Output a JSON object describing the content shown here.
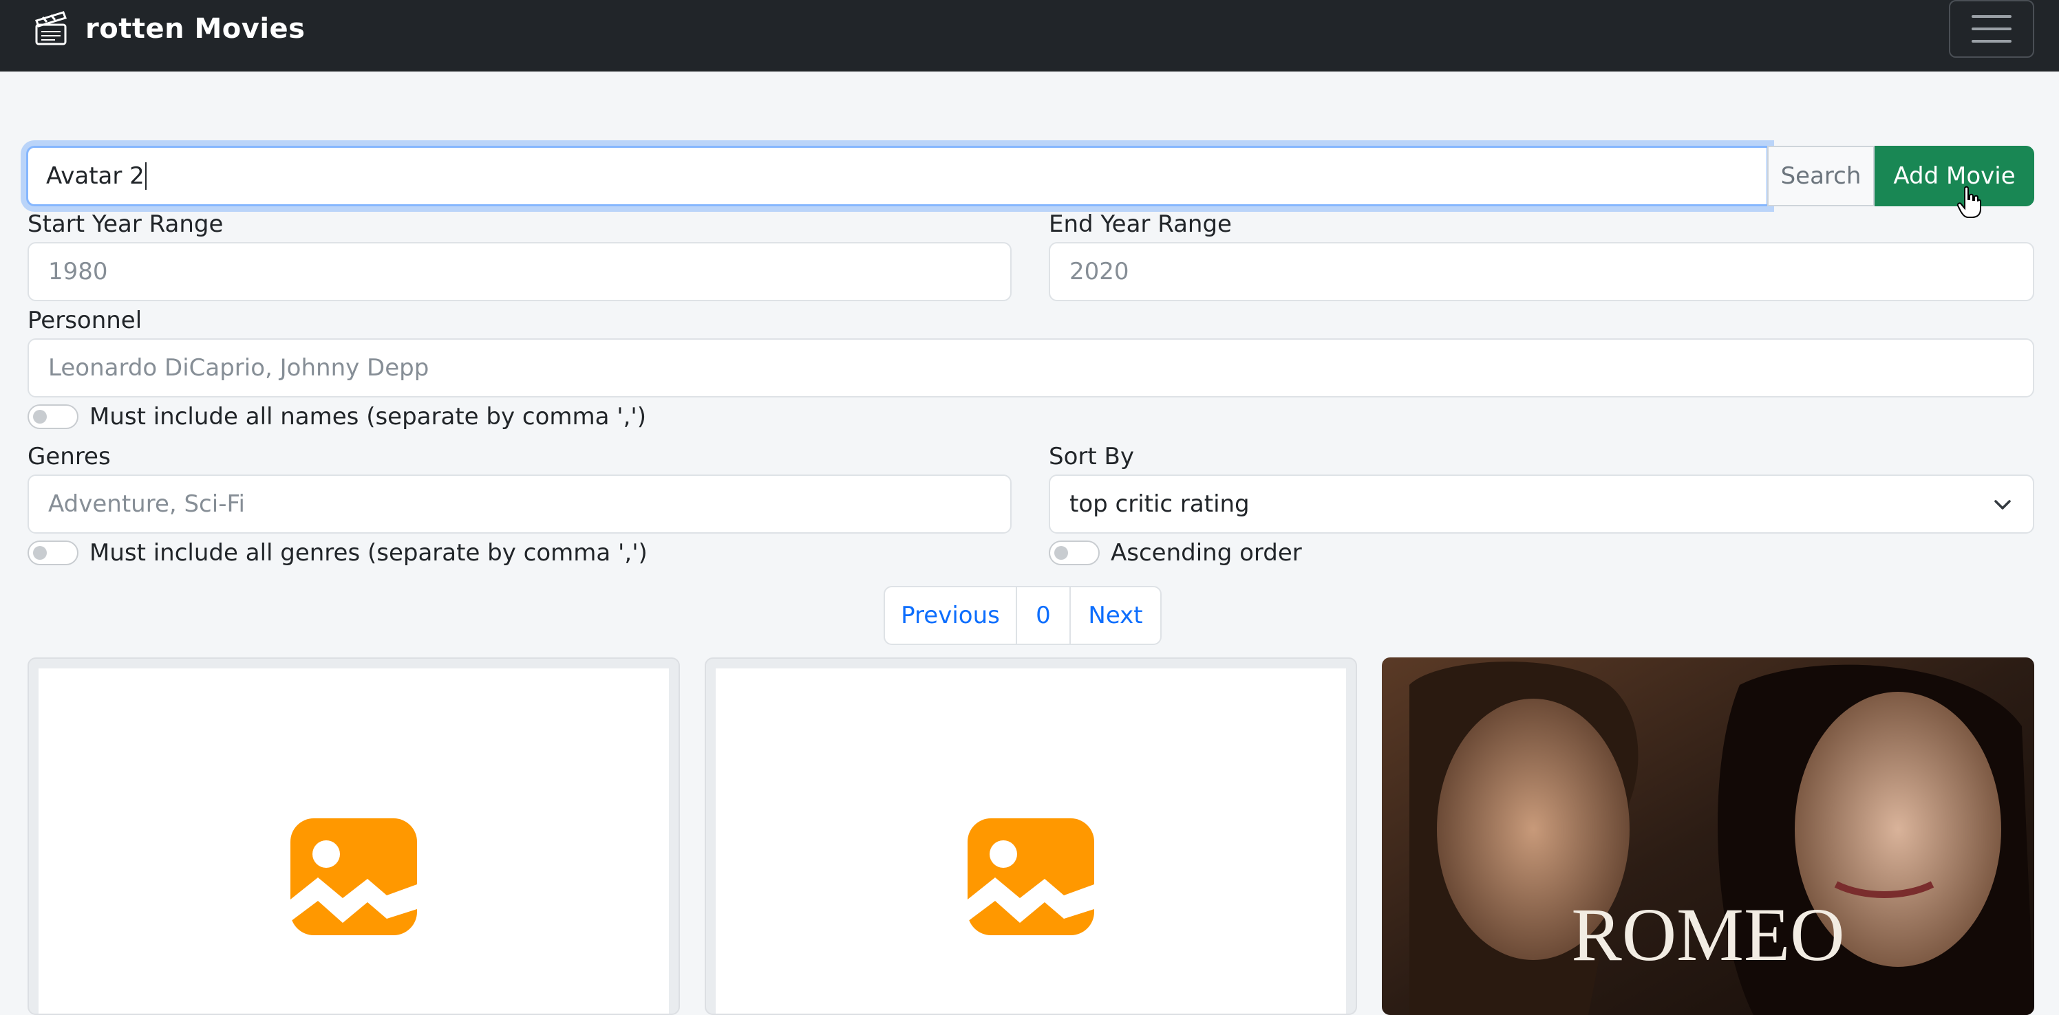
{
  "app": {
    "title": "rotten Movies"
  },
  "search": {
    "value": "Avatar 2",
    "search_label": "Search",
    "add_label": "Add Movie"
  },
  "filters": {
    "start_year": {
      "label": "Start Year Range",
      "placeholder": "1980"
    },
    "end_year": {
      "label": "End Year Range",
      "placeholder": "2020"
    },
    "personnel": {
      "label": "Personnel",
      "placeholder": "Leonardo DiCaprio, Johnny Depp"
    },
    "all_names_label": "Must include all names (separate by comma ',')",
    "genres": {
      "label": "Genres",
      "placeholder": "Adventure, Sci-Fi"
    },
    "all_genres_label": "Must include all genres (separate by comma ',')",
    "sort": {
      "label": "Sort By",
      "value": "top critic rating"
    },
    "ascending_label": "Ascending order"
  },
  "pagination": {
    "previous": "Previous",
    "page": "0",
    "next": "Next"
  },
  "cards": [
    {
      "image": "image-placeholder-icon"
    },
    {
      "image": "image-placeholder-icon"
    },
    {
      "image": "movie-poster",
      "poster_title": "ROMEO"
    }
  ],
  "colors": {
    "navbar": "#212529",
    "primary": "#0d6efd",
    "success": "#198754",
    "placeholder_icon": "#ff9800"
  }
}
